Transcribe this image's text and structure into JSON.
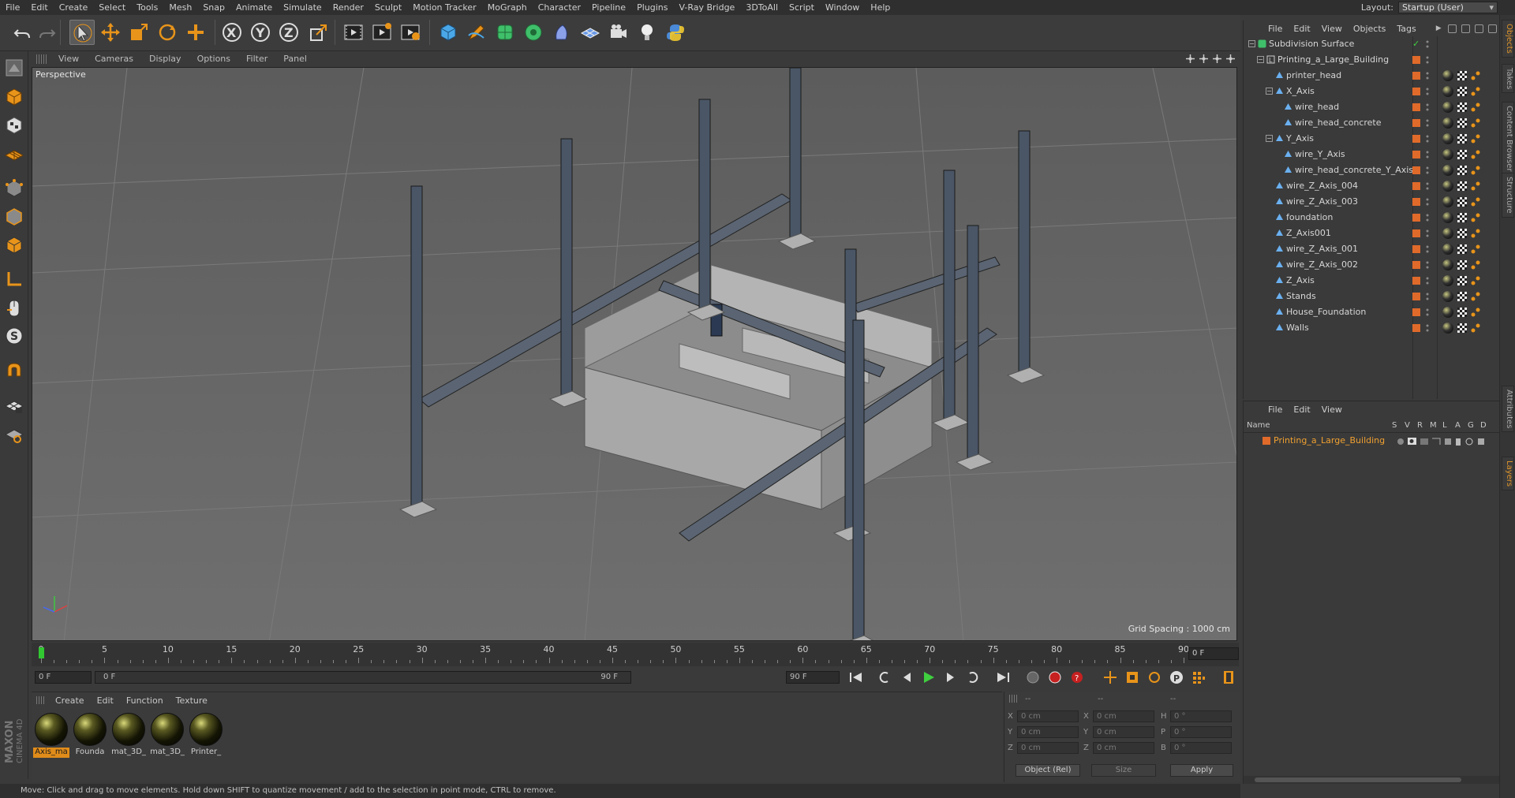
{
  "menubar": {
    "items": [
      "File",
      "Edit",
      "Create",
      "Select",
      "Tools",
      "Mesh",
      "Snap",
      "Animate",
      "Simulate",
      "Render",
      "Sculpt",
      "Motion Tracker",
      "MoGraph",
      "Character",
      "Pipeline",
      "Plugins",
      "V-Ray Bridge",
      "3DToAll",
      "Script",
      "Window",
      "Help"
    ],
    "layout_label": "Layout:",
    "layout_value": "Startup (User)"
  },
  "toolbar": {
    "icons": [
      "undo-icon",
      "redo-icon",
      "live-selection-icon",
      "move-icon",
      "scale-icon",
      "rotate-icon",
      "add-icon",
      "x-axis-lock-icon",
      "y-axis-lock-icon",
      "z-axis-lock-icon",
      "world-coordinates-icon",
      "render-view-icon",
      "render-picture-viewer-icon",
      "edit-render-settings-icon",
      "cube-icon",
      "pen-icon",
      "subdivision-icon",
      "cloner-icon",
      "deformer-icon",
      "floor-icon",
      "camera-icon",
      "light-icon",
      "python-icon"
    ],
    "axis_labels": [
      "X",
      "Y",
      "Z"
    ]
  },
  "viewport": {
    "menu": [
      "View",
      "Cameras",
      "Display",
      "Options",
      "Filter",
      "Panel"
    ],
    "label": "Perspective",
    "grid_spacing": "Grid Spacing : 1000 cm"
  },
  "timeline": {
    "ticks": [
      0,
      5,
      10,
      15,
      20,
      25,
      30,
      35,
      40,
      45,
      50,
      55,
      60,
      65,
      70,
      75,
      80,
      85,
      90
    ],
    "current_frame_field": "0 F",
    "current_frame": 0
  },
  "transport": {
    "start_field": "0 F",
    "range_start": "0 F",
    "range_end": "90 F",
    "end_field": "90 F"
  },
  "materials": {
    "menu": [
      "Create",
      "Edit",
      "Function",
      "Texture"
    ],
    "items": [
      {
        "label": "Axis_ma",
        "selected": true
      },
      {
        "label": "Founda",
        "selected": false
      },
      {
        "label": "mat_3D_",
        "selected": false
      },
      {
        "label": "mat_3D_",
        "selected": false
      },
      {
        "label": "Printer_",
        "selected": false
      }
    ]
  },
  "coordinates": {
    "header_dashes": [
      "--",
      "--",
      "--"
    ],
    "pos_labels": [
      "X",
      "Y",
      "Z"
    ],
    "pos_values": [
      "0 cm",
      "0 cm",
      "0 cm"
    ],
    "size_labels": [
      "X",
      "Y",
      "Z"
    ],
    "size_values": [
      "0 cm",
      "0 cm",
      "0 cm"
    ],
    "rot_labels": [
      "H",
      "P",
      "B"
    ],
    "rot_values": [
      "0 °",
      "0 °",
      "0 °"
    ],
    "mode_select": "Object (Rel)",
    "size_select": "Size",
    "apply": "Apply"
  },
  "statusbar": {
    "text": "Move: Click and drag to move elements. Hold down SHIFT to quantize movement / add to the selection in point mode, CTRL to remove."
  },
  "object_manager": {
    "menu": [
      "File",
      "Edit",
      "View",
      "Objects",
      "Tags"
    ],
    "objects": [
      {
        "name": "Subdivision Surface",
        "depth": 0,
        "type": "subdivision"
      },
      {
        "name": "Printing_a_Large_Building",
        "depth": 1,
        "type": "null"
      },
      {
        "name": "printer_head",
        "depth": 2,
        "type": "mesh"
      },
      {
        "name": "X_Axis",
        "depth": 2,
        "type": "mesh"
      },
      {
        "name": "wire_head",
        "depth": 3,
        "type": "mesh"
      },
      {
        "name": "wire_head_concrete",
        "depth": 3,
        "type": "mesh"
      },
      {
        "name": "Y_Axis",
        "depth": 2,
        "type": "mesh"
      },
      {
        "name": "wire_Y_Axis",
        "depth": 3,
        "type": "mesh"
      },
      {
        "name": "wire_head_concrete_Y_Axis",
        "depth": 3,
        "type": "mesh"
      },
      {
        "name": "wire_Z_Axis_004",
        "depth": 2,
        "type": "mesh"
      },
      {
        "name": "wire_Z_Axis_003",
        "depth": 2,
        "type": "mesh"
      },
      {
        "name": "foundation",
        "depth": 2,
        "type": "mesh"
      },
      {
        "name": "Z_Axis001",
        "depth": 2,
        "type": "mesh"
      },
      {
        "name": "wire_Z_Axis_001",
        "depth": 2,
        "type": "mesh"
      },
      {
        "name": "wire_Z_Axis_002",
        "depth": 2,
        "type": "mesh"
      },
      {
        "name": "Z_Axis",
        "depth": 2,
        "type": "mesh"
      },
      {
        "name": "Stands",
        "depth": 2,
        "type": "mesh"
      },
      {
        "name": "House_Foundation",
        "depth": 2,
        "type": "mesh"
      },
      {
        "name": "Walls",
        "depth": 2,
        "type": "mesh"
      }
    ]
  },
  "layer_manager": {
    "menu": [
      "File",
      "Edit",
      "View"
    ],
    "columns": [
      "Name",
      "S",
      "V",
      "R",
      "M",
      "L",
      "A",
      "G",
      "D"
    ],
    "layers": [
      {
        "name": "Printing_a_Large_Building"
      }
    ]
  },
  "side_tabs": [
    "Objects",
    "Takes",
    "Content Browser",
    "Structure",
    "Attributes",
    "Layers"
  ],
  "colors": {
    "accent_orange": "#e08c1a",
    "layer_orange": "#f0a030",
    "object_color_square": "#e06a2a",
    "playhead_green": "#31c831"
  }
}
